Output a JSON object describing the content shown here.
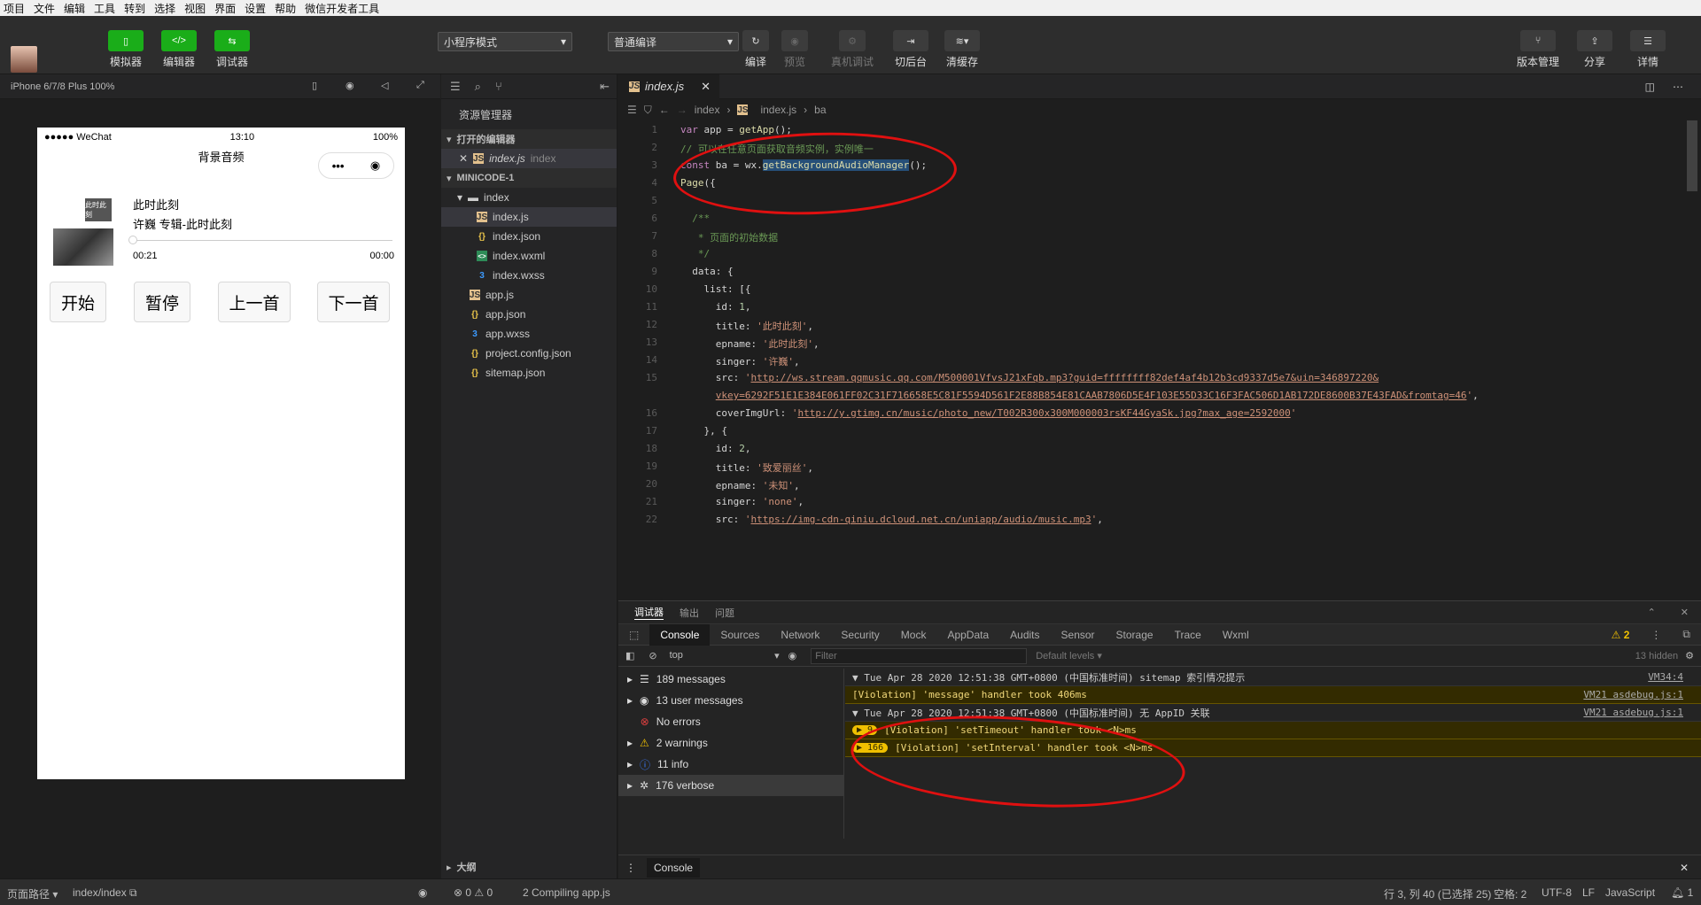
{
  "menubar": [
    "项目",
    "文件",
    "编辑",
    "工具",
    "转到",
    "选择",
    "视图",
    "界面",
    "设置",
    "帮助",
    "微信开发者工具"
  ],
  "toolbar": {
    "simulator": "模拟器",
    "editor": "编辑器",
    "debugger": "调试器",
    "mode": "小程序模式",
    "compile_mode": "普通编译",
    "compile": "编译",
    "preview": "预览",
    "remote_debug": "真机调试",
    "switch_bg": "切后台",
    "clear_cache": "清缓存",
    "version": "版本管理",
    "share": "分享",
    "details": "详情"
  },
  "sim": {
    "device": "iPhone 6/7/8 Plus 100%",
    "carrier": "●●●●● WeChat",
    "time": "13:10",
    "battery": "100%",
    "title": "背景音频",
    "song_title": "此时此刻",
    "song_sub": "许巍 专辑-此时此刻",
    "elapsed": "00:21",
    "remaining": "00:00",
    "cover_text": "此时此刻",
    "progress": 0,
    "buttons": [
      "开始",
      "暂停",
      "上一首",
      "下一首"
    ]
  },
  "explorer": {
    "title": "资源管理器",
    "open_editors": "打开的编辑器",
    "open_file": "index.js",
    "open_file_dir": "index",
    "project": "MINICODE-1",
    "folder": "index",
    "files_in_folder": [
      "index.js",
      "index.json",
      "index.wxml",
      "index.wxss"
    ],
    "root_files": [
      "app.js",
      "app.json",
      "app.wxss",
      "project.config.json",
      "sitemap.json"
    ],
    "outline": "大纲"
  },
  "editor": {
    "tab": "index.js",
    "breadcrumbs": [
      "index",
      "index.js",
      "ba"
    ]
  },
  "devtools": {
    "tabs": [
      "调试器",
      "输出",
      "问题"
    ],
    "panels": [
      "Console",
      "Sources",
      "Network",
      "Security",
      "Mock",
      "AppData",
      "Audits",
      "Sensor",
      "Storage",
      "Trace",
      "Wxml"
    ],
    "warn_count": "2",
    "context": "top",
    "filter_placeholder": "Filter",
    "levels": "Default levels",
    "hidden": "13 hidden",
    "sidebar": [
      "189 messages",
      "13 user messages",
      "No errors",
      "2 warnings",
      "11 info",
      "176 verbose"
    ],
    "messages": [
      {
        "text": "▼ Tue Apr 28 2020 12:51:38 GMT+0800 (中国标准时间) sitemap 索引情况提示",
        "src": "VM34:4",
        "warn": false,
        "badge": ""
      },
      {
        "text": "[Violation] 'message' handler took 406ms",
        "src": "VM21 asdebug.js:1",
        "warn": true,
        "badge": ""
      },
      {
        "text": "▼ Tue Apr 28 2020 12:51:38 GMT+0800 (中国标准时间) 无 AppID 关联",
        "src": "VM21 asdebug.js:1",
        "warn": false,
        "badge": ""
      },
      {
        "text": "[Violation] 'setTimeout' handler took <N>ms",
        "src": "",
        "warn": true,
        "badge": "▶ 9"
      },
      {
        "text": "[Violation] 'setInterval' handler took <N>ms",
        "src": "",
        "warn": true,
        "badge": "▶ 166"
      }
    ],
    "console_label": "Console"
  },
  "status": {
    "page_path_label": "页面路径",
    "page_path": "index/index",
    "errors": "⊗ 0 ⚠ 0",
    "compiling": "2 Compiling app.js",
    "cursor": "行 3, 列 40 (已选择 25)",
    "spaces": "空格: 2",
    "encoding": "UTF-8",
    "eol": "LF",
    "lang": "JavaScript",
    "notifications": "1"
  }
}
